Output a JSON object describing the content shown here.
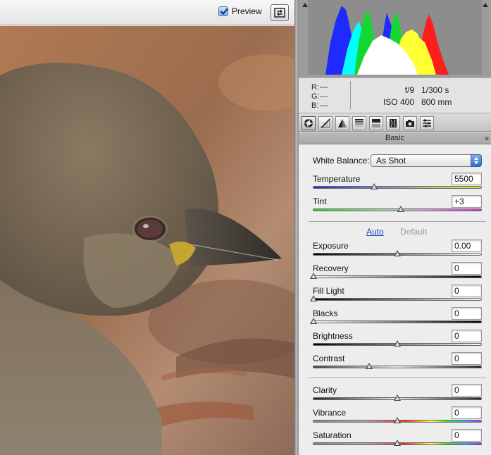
{
  "toolbar": {
    "preview_label": "Preview",
    "preview_checked": true,
    "fullscreen_icon": "fullscreen-toggle-icon"
  },
  "photo": {
    "subject": "sparrow-photo",
    "colors": {
      "background": "#9a7f68",
      "head": "#7c6c58",
      "beak": "#4a4640"
    }
  },
  "histogram": {
    "background": "#8d8d8d",
    "channels": [
      "blue",
      "cyan",
      "green",
      "white",
      "yellow",
      "red"
    ]
  },
  "readout": {
    "r_label": "R:",
    "r_value": "---",
    "g_label": "G:",
    "g_value": "---",
    "b_label": "B:",
    "b_value": "---",
    "aperture": "f/9",
    "shutter": "1/300 s",
    "iso": "ISO 400",
    "focal_length": "800 mm"
  },
  "tabs": [
    {
      "icon": "aperture-icon",
      "selected": true
    },
    {
      "icon": "tone-curve-icon",
      "selected": false
    },
    {
      "icon": "detail-triangle-icon",
      "selected": false
    },
    {
      "icon": "hsl-grayscale-icon",
      "selected": false
    },
    {
      "icon": "split-toning-icon",
      "selected": false
    },
    {
      "icon": "lens-corrections-icon",
      "selected": false
    },
    {
      "icon": "camera-calibration-icon",
      "selected": false
    },
    {
      "icon": "presets-icon",
      "selected": false
    }
  ],
  "panel": {
    "title": "Basic",
    "menu_icon": "panel-menu-icon"
  },
  "white_balance": {
    "label": "White Balance:",
    "value": "As Shot"
  },
  "temperature": {
    "label": "Temperature",
    "value": "5500",
    "position": 0.36
  },
  "tint": {
    "label": "Tint",
    "value": "+3",
    "position": 0.52
  },
  "tone_links": {
    "auto": "Auto",
    "default": "Default"
  },
  "sliders": [
    {
      "label": "Exposure",
      "value": "0.00",
      "position": 0.5
    },
    {
      "label": "Recovery",
      "value": "0",
      "position": 0.0
    },
    {
      "label": "Fill Light",
      "value": "0",
      "position": 0.0
    },
    {
      "label": "Blacks",
      "value": "0",
      "position": 0.0
    },
    {
      "label": "Brightness",
      "value": "0",
      "position": 0.5
    },
    {
      "label": "Contrast",
      "value": "0",
      "position": 0.33
    }
  ],
  "presence": [
    {
      "label": "Clarity",
      "value": "0",
      "position": 0.5
    },
    {
      "label": "Vibrance",
      "value": "0",
      "position": 0.5
    },
    {
      "label": "Saturation",
      "value": "0",
      "position": 0.5
    }
  ]
}
